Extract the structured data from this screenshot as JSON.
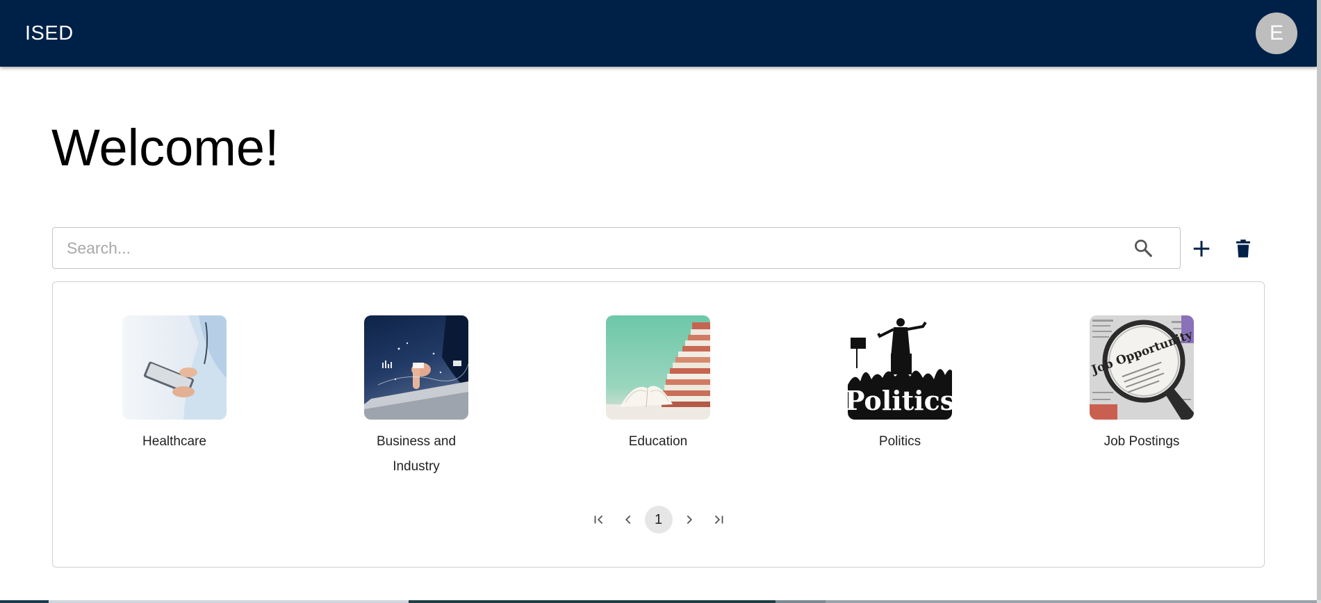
{
  "appbar": {
    "title": "ISED",
    "avatar_initial": "E"
  },
  "main": {
    "heading": "Welcome!",
    "search": {
      "placeholder": "Search...",
      "value": "",
      "icon": "search-icon"
    },
    "actions": [
      {
        "name": "add",
        "icon": "plus-icon"
      },
      {
        "name": "delete",
        "icon": "trash-icon"
      }
    ]
  },
  "categories": [
    {
      "label": "Healthcare",
      "image": "doctor-with-tablet"
    },
    {
      "label": "Business and Industry",
      "image": "laptop-with-data"
    },
    {
      "label": "Education",
      "image": "stack-of-books"
    },
    {
      "label": "Politics",
      "image": "politics-crowd-silhouette",
      "image_text": "Politics"
    },
    {
      "label": "Job Postings",
      "image": "magnifier-on-newspaper",
      "image_text": "Job Opportunity"
    }
  ],
  "pagination": {
    "current_page": "1",
    "controls": [
      "first-page",
      "previous-page",
      "next-page",
      "last-page"
    ]
  },
  "colors": {
    "appbar": "#002147",
    "accent": "#002147",
    "avatar": "#bdbdbd"
  }
}
